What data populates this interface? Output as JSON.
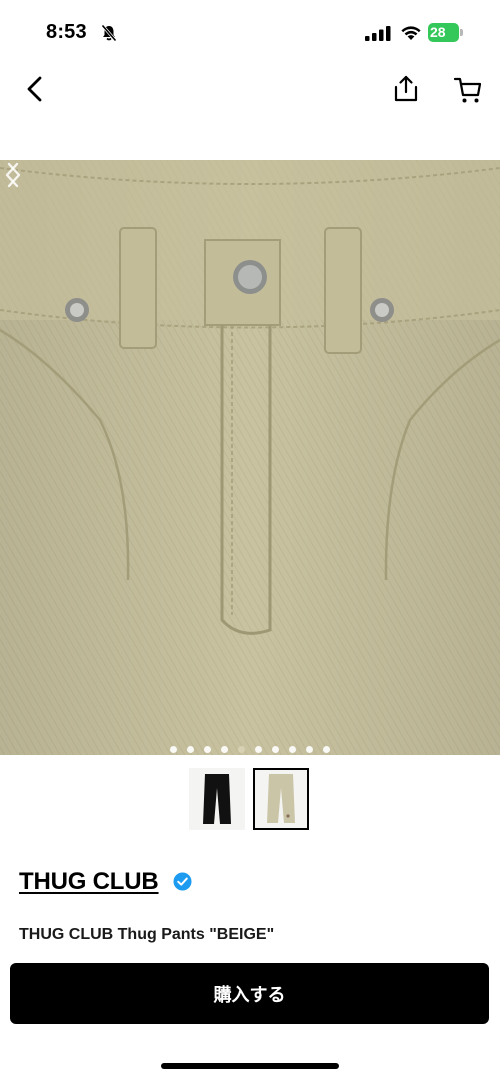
{
  "status_bar": {
    "time": "8:53",
    "battery_level": "28"
  },
  "nav": {
    "icons": [
      "chevron-left-icon",
      "share-icon",
      "cart-icon"
    ]
  },
  "carousel": {
    "dot_count": 10,
    "active_index": 4
  },
  "thumbnails": [
    {
      "name": "black-pants"
    },
    {
      "name": "beige-pants",
      "selected": true
    }
  ],
  "product": {
    "brand": "THUG CLUB",
    "title": "THUG CLUB Thug Pants \"BEIGE\""
  },
  "actions": {
    "buy_label": "購入する"
  },
  "colors": {
    "accent": "#000000",
    "verified": "#1d9bf0",
    "battery": "#34c759",
    "fabric": "#c9c3a1"
  }
}
